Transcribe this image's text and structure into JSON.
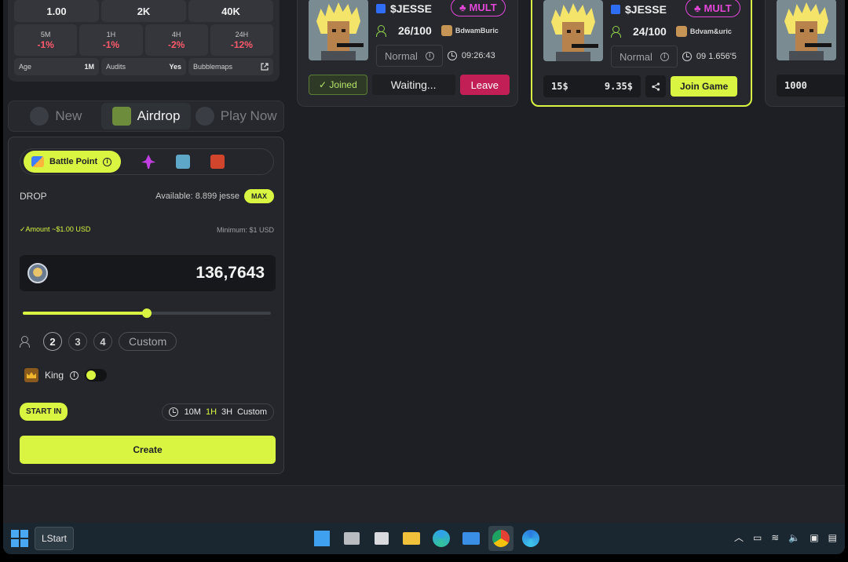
{
  "stats": {
    "top_values": [
      "1.00",
      "2K",
      "40K"
    ],
    "changes": [
      {
        "label": "5M",
        "value": "-1%"
      },
      {
        "label": "1H",
        "value": "-1%"
      },
      {
        "label": "4H",
        "value": "-2%"
      },
      {
        "label": "24H",
        "value": "-12%"
      }
    ],
    "info": [
      {
        "label": "Age",
        "value": "1M"
      },
      {
        "label": "Audits",
        "value": "Yes"
      },
      {
        "label": "Bubblemaps",
        "value": ""
      }
    ]
  },
  "mode_tabs": [
    {
      "label": "New",
      "active": false
    },
    {
      "label": "Airdrop",
      "active": true
    },
    {
      "label": "Play Now",
      "active": false
    }
  ],
  "form": {
    "point_tab_label": "Battle Point",
    "drop_label": "DROP",
    "available_text": "Available: 8.899 jesse",
    "max_label": "MAX",
    "amount_text": "✓Amount ~$1.00 USD",
    "minimum_text": "Minimum: $1 USD",
    "amount_value": "136,7643",
    "slider_fraction": 0.5,
    "player_options": [
      "2",
      "3",
      "4"
    ],
    "player_custom": "Custom",
    "selected_players": "2",
    "king_label": "King",
    "start_label": "START IN",
    "time_options": [
      "10M",
      "1H",
      "3H",
      "Custom"
    ],
    "selected_time": "1H",
    "create_label": "Create"
  },
  "cards": [
    {
      "token": "$JESSE",
      "mult": "MULT",
      "players": "26/100",
      "creator": "BdwamBuric",
      "mode": "Normal",
      "timer": "09:26:43",
      "joined_label": "✓ Joined",
      "waiting_label": "Waiting...",
      "leave_label": "Leave"
    },
    {
      "token": "$JESSE",
      "mult": "MULT",
      "players": "24/100",
      "creator": "Bdvam&uric",
      "mode": "Normal",
      "timer": "09 1.656'5",
      "bet_left": "15$",
      "bet_right": "9.35$",
      "join_label": "Join Game"
    },
    {
      "bet_left": "1000"
    }
  ],
  "taskbar": {
    "start_label": "LStart"
  },
  "colors": {
    "accent": "#d9f542",
    "danger": "#ff5a6b",
    "leave": "#c21f57",
    "mult": "#e247d7",
    "background": "#1d1f24"
  }
}
